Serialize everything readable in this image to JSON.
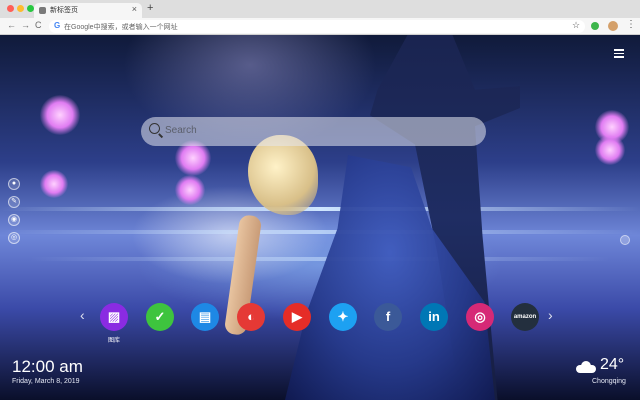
{
  "browser": {
    "tab_title": "新标签页",
    "tab_close": "×",
    "new_tab": "+",
    "omnibox_placeholder": "在Google中搜索，或者输入一个网址",
    "google_letter": "G",
    "nav": {
      "back": "←",
      "forward": "→",
      "reload": "C"
    },
    "star": "☆",
    "menu": "⋮"
  },
  "search": {
    "placeholder": "Search"
  },
  "side_icons": [
    "●",
    "✎",
    "◉",
    "◎"
  ],
  "quick_links": [
    {
      "name": "gallery",
      "glyph": "▨",
      "color": "#8a2be2",
      "label": "图库"
    },
    {
      "name": "checklist",
      "glyph": "✓",
      "color": "#3ec43e",
      "label": ""
    },
    {
      "name": "notes",
      "glyph": "▤",
      "color": "#1e88e5",
      "label": ""
    },
    {
      "name": "paint",
      "glyph": "◐",
      "color": "#e53935",
      "label": ""
    },
    {
      "name": "youtube",
      "glyph": "▶",
      "color": "#e52d27",
      "label": ""
    },
    {
      "name": "twitter",
      "glyph": "✦",
      "color": "#1da1f2",
      "label": ""
    },
    {
      "name": "facebook",
      "glyph": "f",
      "color": "#3b5998",
      "label": ""
    },
    {
      "name": "linkedin",
      "glyph": "in",
      "color": "#0077b5",
      "label": ""
    },
    {
      "name": "instagram",
      "glyph": "◎",
      "color": "#d62976",
      "label": ""
    },
    {
      "name": "amazon",
      "glyph": "amazon",
      "color": "#232f3e",
      "label": ""
    }
  ],
  "dock_arrows": {
    "left": "‹",
    "right": "›"
  },
  "clock": {
    "time": "12:00 am",
    "date": "Friday, March 8, 2019"
  },
  "weather": {
    "temperature": "24°",
    "city": "Chongqing"
  }
}
